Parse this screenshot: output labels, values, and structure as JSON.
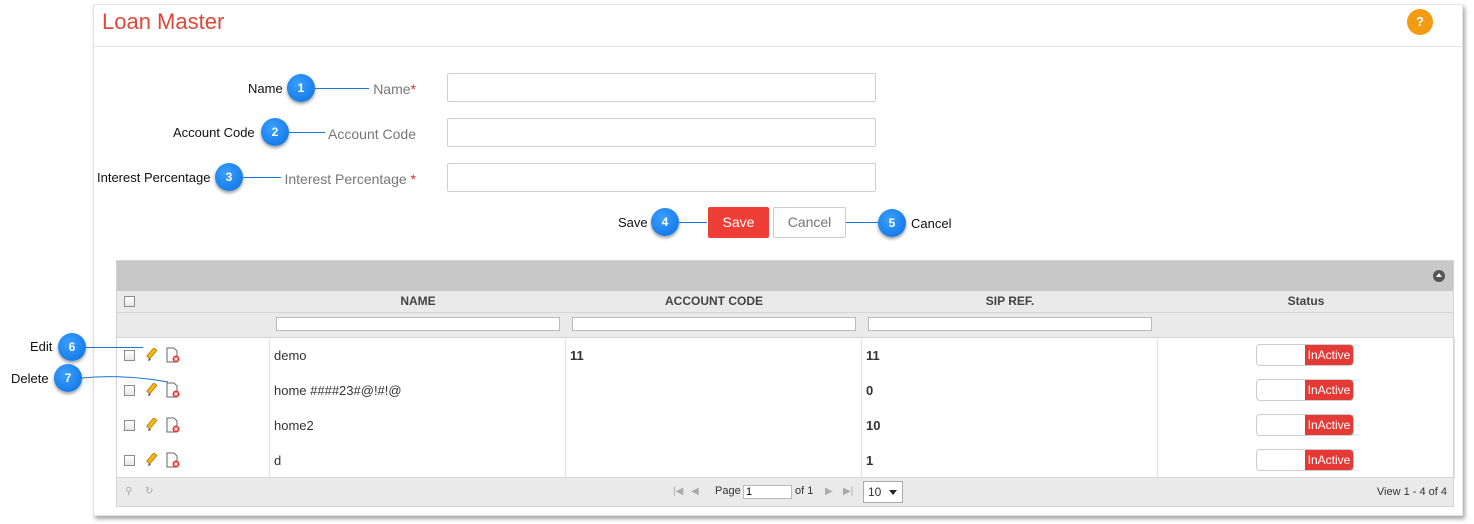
{
  "panel": {
    "title": "Loan Master",
    "help_label": "?"
  },
  "form": {
    "name_label": "Name",
    "account_code_label": "Account Code",
    "interest_label": "Interest Percentage",
    "required_mark": "*",
    "save_label": "Save",
    "cancel_label": "Cancel"
  },
  "grid": {
    "columns": [
      "NAME",
      "ACCOUNT CODE",
      "SIP REF.",
      "Status"
    ],
    "rows": [
      {
        "name": "demo",
        "account_code": "11",
        "sip_ref": "11",
        "status": "InActive"
      },
      {
        "name": "home ####23#@!#!@",
        "account_code": "",
        "sip_ref": "0",
        "status": "InActive"
      },
      {
        "name": "home2",
        "account_code": "",
        "sip_ref": "10",
        "status": "InActive"
      },
      {
        "name": "d",
        "account_code": "",
        "sip_ref": "1",
        "status": "InActive"
      }
    ],
    "pager": {
      "page_label": "Page",
      "page_value": "1",
      "of_label": "of 1",
      "rows_per_page": "10",
      "view_info": "View 1 - 4 of 4"
    }
  },
  "callouts": [
    {
      "num": "1",
      "label": "Name"
    },
    {
      "num": "2",
      "label": "Account Code"
    },
    {
      "num": "3",
      "label": "Interest Percentage"
    },
    {
      "num": "4",
      "label": "Save"
    },
    {
      "num": "5",
      "label": "Cancel"
    },
    {
      "num": "6",
      "label": "Edit"
    },
    {
      "num": "7",
      "label": "Delete"
    }
  ],
  "colors": {
    "title": "#e0473b",
    "save": "#ef3e36",
    "callout": "#0a6ee0",
    "status_inactive": "#e53935",
    "help": "#f39c12"
  }
}
